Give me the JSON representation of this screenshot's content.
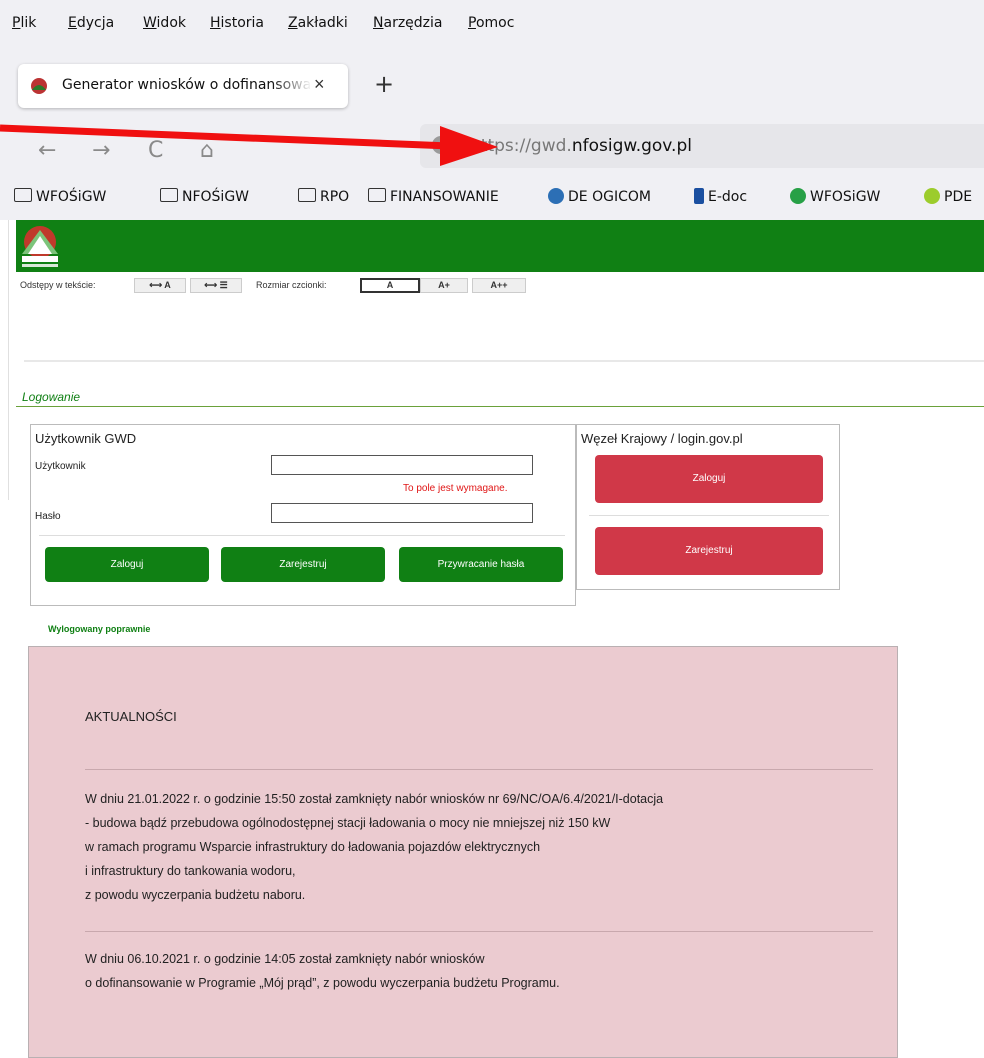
{
  "menu": {
    "items": [
      "Plik",
      "Edycja",
      "Widok",
      "Historia",
      "Zakładki",
      "Narzędzia",
      "Pomoc"
    ]
  },
  "tab": {
    "title": "Generator wniosków o dofinansowanie",
    "close": "×",
    "new_tab": "+"
  },
  "nav": {
    "back": "←",
    "forward": "→",
    "reload": "C",
    "home": "⌂",
    "url_scheme": "https://gwd.",
    "url_host": "nfosigw.gov.pl"
  },
  "bookmarks": [
    {
      "label": "WFOŚiGW",
      "icon": "folder-icon"
    },
    {
      "label": "NFOŚiGW",
      "icon": "folder-icon"
    },
    {
      "label": "RPO",
      "icon": "folder-icon"
    },
    {
      "label": "FINANSOWANIE",
      "icon": "folder-icon"
    },
    {
      "label": "DE OGICOM",
      "icon": "ogicom-icon"
    },
    {
      "label": "E-doc",
      "icon": "edoc-icon"
    },
    {
      "label": "WFOSiGW",
      "icon": "wfosigw-icon"
    },
    {
      "label": "PDE",
      "icon": "pde-icon"
    }
  ],
  "toolbar": {
    "spacing_label": "Odstępy w tekście:",
    "spacing_letters": "⟷ A",
    "spacing_lines": "⟷ ☰",
    "font_size_label": "Rozmiar czcionki:",
    "font_a": "A",
    "font_a_plus": "A+",
    "font_a_plus_plus": "A++"
  },
  "login": {
    "section_title": "Logowanie",
    "gwd": {
      "title": "Użytkownik GWD",
      "user_label": "Użytkownik",
      "user_value": "",
      "required_msg": "To pole jest wymagane.",
      "password_label": "Hasło",
      "password_value": "",
      "login_btn": "Zaloguj",
      "register_btn": "Zarejestruj",
      "recover_btn": "Przywracanie hasła"
    },
    "wk": {
      "title": "Węzeł Krajowy / login.gov.pl",
      "login_btn": "Zaloguj",
      "register_btn": "Zarejestruj"
    },
    "logout_msg": "Wylogowany poprawnie"
  },
  "news": {
    "title": "AKTUALNOŚCI",
    "items": [
      {
        "lines": [
          "W dniu 21.01.2022 r. o godzinie 15:50 został zamknięty nabór wniosków nr 69/NC/OA/6.4/2021/I-dotacja",
          "- budowa bądź przebudowa ogólnodostępnej stacji ładowania o mocy nie mniejszej niż 150 kW",
          "w ramach programu Wsparcie infrastruktury do ładowania pojazdów elektrycznych",
          "i infrastruktury do tankowania wodoru,",
          "z powodu wyczerpania budżetu naboru."
        ]
      },
      {
        "lines": [
          "W dniu 06.10.2021 r. o godzinie 14:05 został zamknięty nabór wniosków",
          "o dofinansowanie w Programie „Mój prąd”, z powodu wyczerpania budżetu Programu."
        ]
      }
    ]
  },
  "colors": {
    "brand_green": "#108014",
    "wk_red": "#d03848",
    "news_bg": "#ebcbd0",
    "error_red": "#e01616"
  }
}
